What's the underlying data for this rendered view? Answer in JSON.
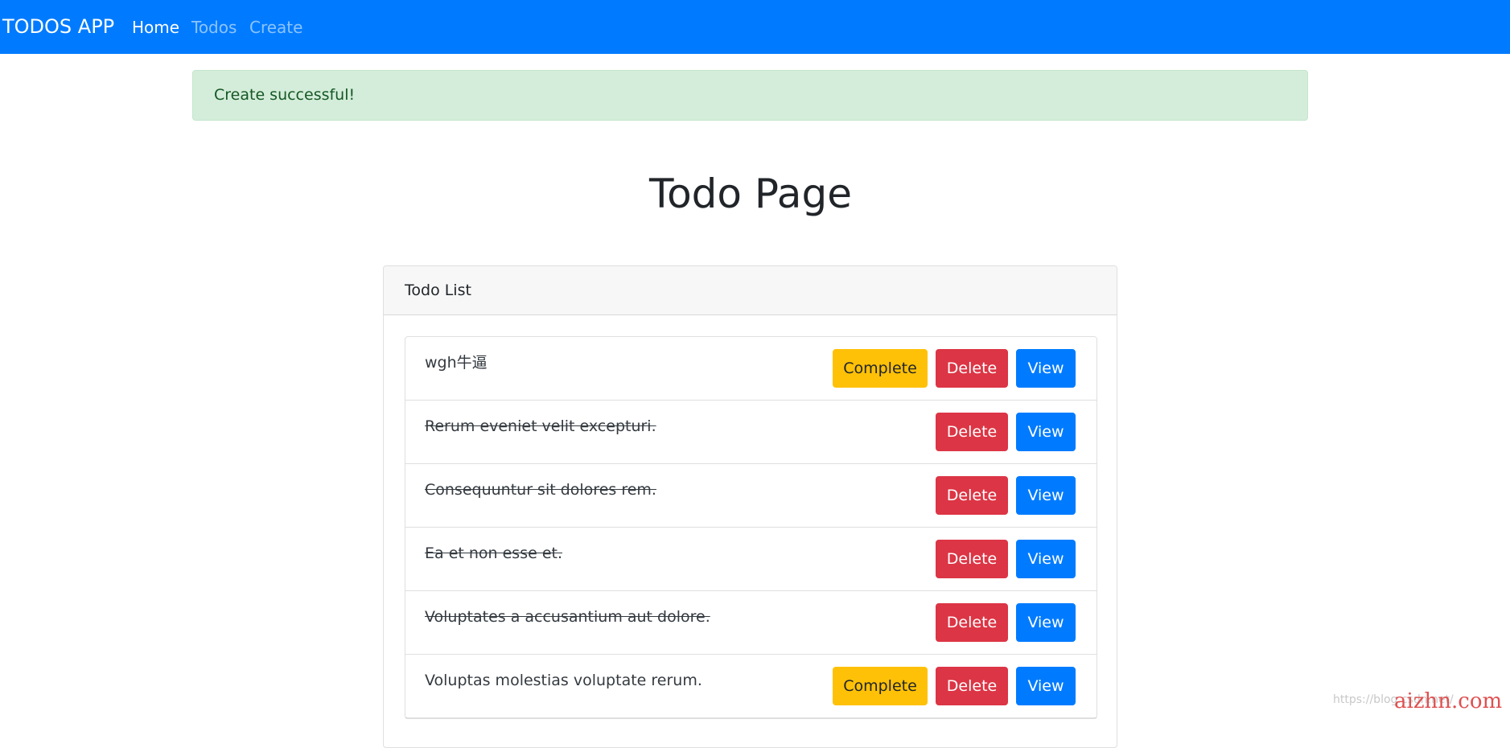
{
  "navbar": {
    "brand": "TODOS APP",
    "links": [
      {
        "label": "Home",
        "active": true
      },
      {
        "label": "Todos",
        "active": false
      },
      {
        "label": "Create",
        "active": false
      }
    ],
    "bg_color": "#007bff"
  },
  "alert": {
    "message": "Create successful!"
  },
  "page": {
    "title": "Todo Page"
  },
  "card": {
    "header": "Todo List"
  },
  "buttons": {
    "complete": "Complete",
    "delete": "Delete",
    "view": "View"
  },
  "todos": [
    {
      "text": "wgh牛逼",
      "completed": false
    },
    {
      "text": "Rerum eveniet velit excepturi.",
      "completed": true
    },
    {
      "text": "Consequuntur sit dolores rem.",
      "completed": true
    },
    {
      "text": "Ea et non esse et.",
      "completed": true
    },
    {
      "text": "Voluptates a accusantium aut dolore.",
      "completed": true
    },
    {
      "text": "Voluptas molestias voluptate rerum.",
      "completed": false
    }
  ],
  "watermark": {
    "url": "https://blog.csdn.net/",
    "logo": "aizhn.com"
  },
  "colors": {
    "primary": "#007bff",
    "danger": "#dc3545",
    "warning": "#ffc107",
    "success_bg": "#d4edda",
    "success_text": "#155724"
  }
}
